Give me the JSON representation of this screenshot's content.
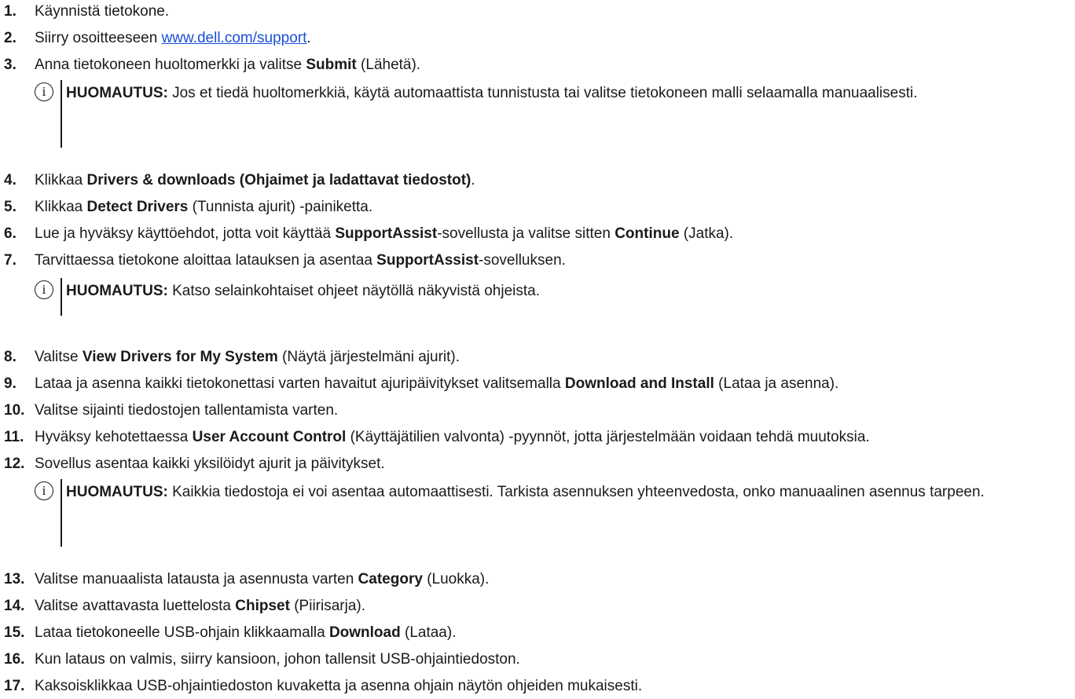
{
  "steps": [
    {
      "n": "1.",
      "a": "Käynnistä tietokone."
    },
    {
      "n": "2.",
      "a": "Siirry osoitteeseen ",
      "link": "www.dell.com/support",
      "c": "."
    },
    {
      "n": "3.",
      "a": "Anna tietokoneen huoltomerkki ja valitse ",
      "b": "Submit",
      "c": " (Lähetä)."
    },
    {
      "n": "4.",
      "a": "Klikkaa ",
      "b": "Drivers & downloads (Ohjaimet ja ladattavat tiedostot)",
      "c": "."
    },
    {
      "n": "5.",
      "a": "Klikkaa ",
      "b": "Detect Drivers",
      "c": " (Tunnista ajurit) -painiketta."
    },
    {
      "n": "6.",
      "a": "Lue ja hyväksy käyttöehdot, jotta voit käyttää ",
      "b": "SupportAssist",
      "c": "-sovellusta ja valitse sitten ",
      "d": "Continue",
      "e": " (Jatka)."
    },
    {
      "n": "7.",
      "a": "Tarvittaessa tietokone aloittaa latauksen ja asentaa ",
      "b": "SupportAssist",
      "c": "-sovelluksen."
    },
    {
      "n": "8.",
      "a": "Valitse ",
      "b": "View Drivers for My System",
      "c": " (Näytä järjestelmäni ajurit)."
    },
    {
      "n": "9.",
      "a": "Lataa ja asenna kaikki tietokonettasi varten havaitut ajuripäivitykset valitsemalla ",
      "b": "Download and Install",
      "c": " (Lataa ja asenna)."
    },
    {
      "n": "10.",
      "a": "Valitse sijainti tiedostojen tallentamista varten."
    },
    {
      "n": "11.",
      "a": "Hyväksy kehotettaessa ",
      "b": "User Account Control",
      "c": " (Käyttäjätilien valvonta) -pyynnöt, jotta järjestelmään voidaan tehdä muutoksia."
    },
    {
      "n": "12.",
      "a": "Sovellus asentaa kaikki yksilöidyt ajurit ja päivitykset."
    },
    {
      "n": "13.",
      "a": "Valitse manuaalista latausta ja asennusta varten ",
      "b": "Category",
      "c": " (Luokka)."
    },
    {
      "n": "14.",
      "a": "Valitse avattavasta luettelosta ",
      "b": "Chipset",
      "c": " (Piirisarja)."
    },
    {
      "n": "15.",
      "a": "Lataa tietokoneelle USB-ohjain klikkaamalla ",
      "b": "Download",
      "c": " (Lataa)."
    },
    {
      "n": "16.",
      "a": "Kun lataus on valmis, siirry kansioon, johon tallensit USB-ohjaintiedoston."
    },
    {
      "n": "17.",
      "a": "Kaksoisklikkaa USB-ohjaintiedoston kuvaketta ja asenna ohjain näytön ohjeiden mukaisesti."
    }
  ],
  "notes": [
    {
      "icon": "info-icon",
      "glyph": "i",
      "label": "HUOMAUTUS:",
      "text": " Jos et tiedä huoltomerkkiä, käytä automaattista tunnistusta tai valitse tietokoneen malli selaamalla manuaalisesti."
    },
    {
      "icon": "info-icon",
      "glyph": "i",
      "label": "HUOMAUTUS:",
      "text": " Katso selainkohtaiset ohjeet näytöllä näkyvistä ohjeista."
    },
    {
      "icon": "info-icon",
      "glyph": "i",
      "label": "HUOMAUTUS:",
      "text": " Kaikkia tiedostoja ei voi asentaa automaattisesti. Tarkista asennuksen yhteenvedosta, onko manuaalinen asennus tarpeen."
    }
  ],
  "colors": {
    "text": "#1a1a1a",
    "link": "#1a4fd8",
    "background": "#ffffff"
  }
}
